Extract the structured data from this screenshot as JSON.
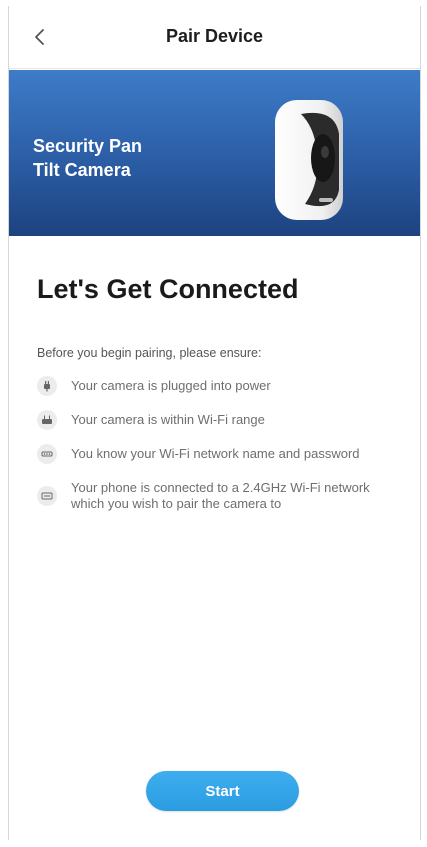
{
  "header": {
    "title": "Pair Device",
    "back_icon": "chevron-left-icon"
  },
  "banner": {
    "title": "Security Pan\nTilt Camera",
    "image": "pan-tilt-camera-illustration",
    "gradient_top": "#3d7cc8",
    "gradient_bottom": "#1d427f"
  },
  "main": {
    "heading": "Let's Get Connected",
    "intro": "Before you begin pairing, please ensure:",
    "checklist": [
      {
        "icon": "power-plug-icon",
        "text": "Your camera is plugged into power"
      },
      {
        "icon": "router-icon",
        "text": "Your camera is within Wi-Fi range"
      },
      {
        "icon": "password-icon",
        "text": "You know your Wi-Fi network name and password"
      },
      {
        "icon": "phone-wifi-icon",
        "text": "Your phone is connected to a 2.4GHz Wi-Fi network which you wish to pair the camera to"
      }
    ]
  },
  "actions": {
    "start_label": "Start",
    "accent_color": "#2a9ce0"
  }
}
